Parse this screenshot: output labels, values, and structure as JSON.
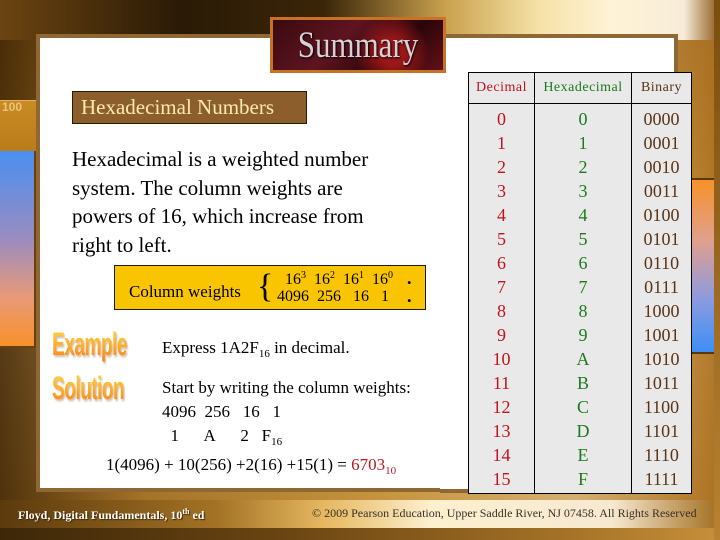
{
  "slide": {
    "title": "Summary",
    "heading": "Hexadecimal Numbers",
    "body_lines": [
      "Hexadecimal is a weighted number",
      "system.  The column weights are",
      "powers of 16, which increase from",
      "right to left."
    ],
    "column_weights": {
      "label": "Column weights",
      "base": "16",
      "exponents": [
        "3",
        "2",
        "1",
        "0"
      ],
      "values": [
        "4096",
        "256",
        "16",
        "1"
      ]
    },
    "example": {
      "label": "Example",
      "prompt_prefix": "Express 1A2F",
      "prompt_subscript": "16",
      "prompt_suffix": " in decimal."
    },
    "solution": {
      "label": "Solution",
      "line1": "Start by writing the column weights:",
      "line2": "4096  256   16   1",
      "line3_digits": "  1      A      2   F",
      "line3_subscript": "16",
      "equation": "1(4096) + 10(256) +2(16) +15(1) = ",
      "answer": "6703",
      "answer_subscript": "10"
    },
    "decorations": {
      "left_strip_text": "100"
    }
  },
  "table": {
    "headers": [
      "Decimal",
      "Hexadecimal",
      "Binary"
    ],
    "rows": [
      [
        "0",
        "0",
        "0000"
      ],
      [
        "1",
        "1",
        "0001"
      ],
      [
        "2",
        "2",
        "0010"
      ],
      [
        "3",
        "3",
        "0011"
      ],
      [
        "4",
        "4",
        "0100"
      ],
      [
        "5",
        "5",
        "0101"
      ],
      [
        "6",
        "6",
        "0110"
      ],
      [
        "7",
        "7",
        "0111"
      ],
      [
        "8",
        "8",
        "1000"
      ],
      [
        "9",
        "9",
        "1001"
      ],
      [
        "10",
        "A",
        "1010"
      ],
      [
        "11",
        "B",
        "1011"
      ],
      [
        "12",
        "C",
        "1100"
      ],
      [
        "13",
        "D",
        "1101"
      ],
      [
        "14",
        "E",
        "1110"
      ],
      [
        "15",
        "F",
        "1111"
      ]
    ],
    "colors": {
      "decimal": "#c0141c",
      "hexadecimal": "#1c7a1c",
      "binary": "#5a3415"
    }
  },
  "footer": {
    "left_prefix": "Floyd, Digital Fundamentals, 10",
    "left_sup": "th",
    "left_suffix": " ed",
    "right": "© 2009 Pearson Education, Upper Saddle River, NJ 07458. All Rights Reserved"
  },
  "colors": {
    "frame": "#8e6733",
    "heading_bg": "#8c5e2c",
    "heading_text": "#ffeaa8",
    "weights_bg": "#f9c400",
    "answer": "#b81820"
  }
}
